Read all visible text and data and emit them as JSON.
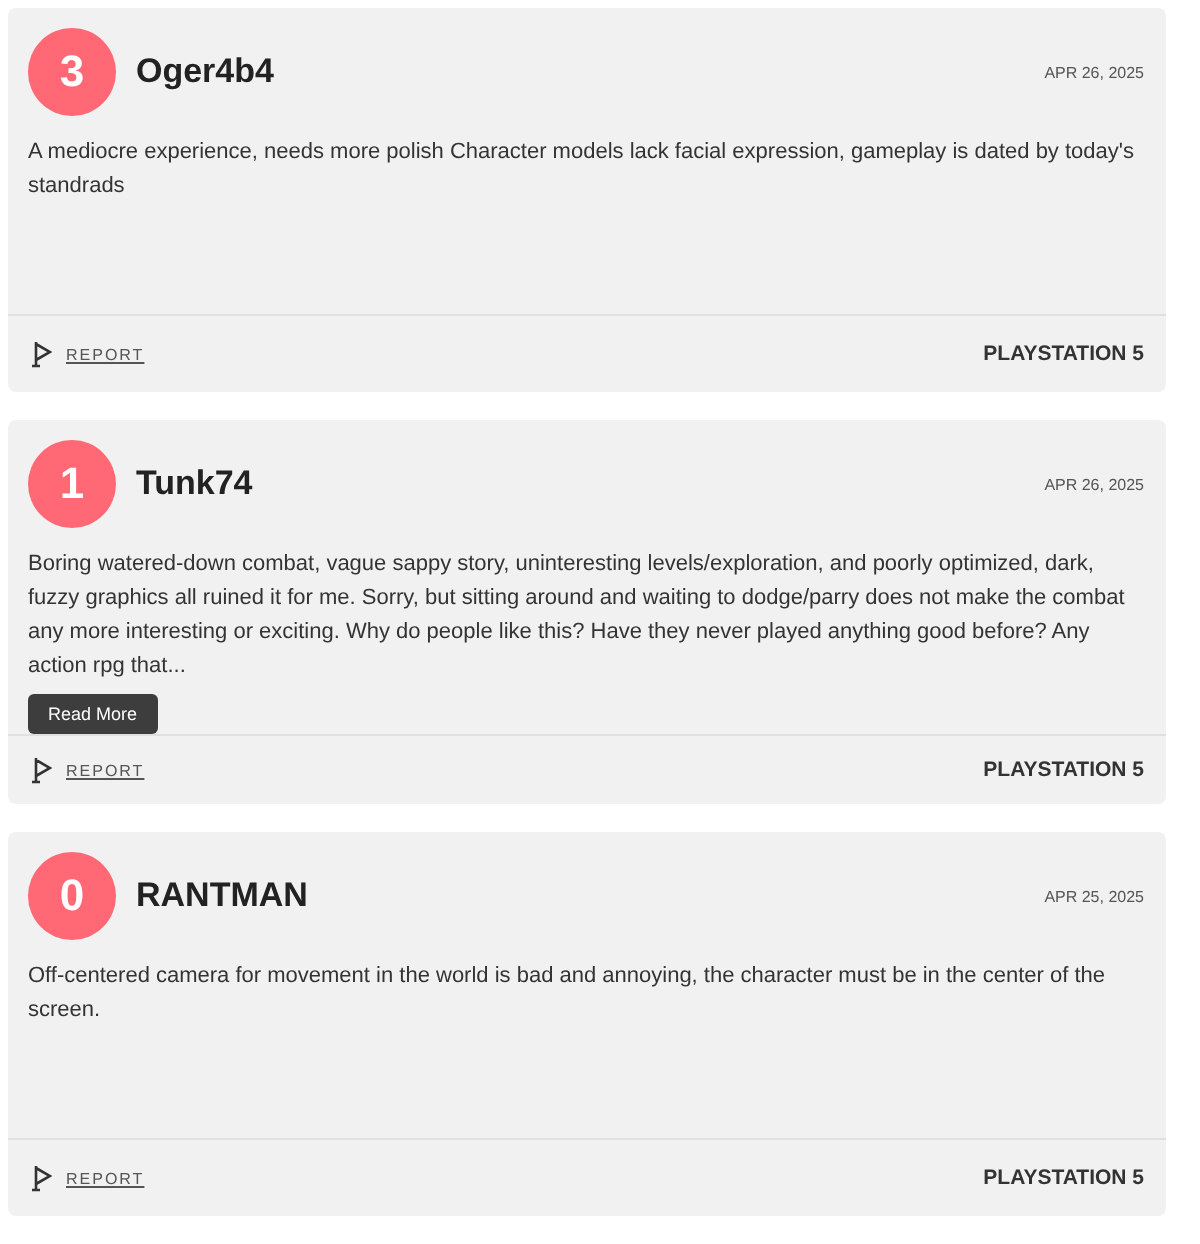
{
  "reviews": [
    {
      "score": "3",
      "author": "Oger4b4",
      "date": "APR 26, 2025",
      "text": "A mediocre experience, needs more polish Character models lack facial expression, gameplay is dated by today's standrads",
      "report": "REPORT",
      "platform": "PLAYSTATION 5"
    },
    {
      "score": "1",
      "author": "Tunk74",
      "date": "APR 26, 2025",
      "text": "Boring watered-down combat, vague sappy story, uninteresting levels/exploration, and poorly optimized, dark, fuzzy graphics all ruined it for me. Sorry, but sitting around and waiting to dodge/parry does not make the combat any more interesting or exciting. Why do people like this? Have they never played anything good before? Any action rpg that...",
      "read_more": "Read More",
      "report": "REPORT",
      "platform": "PLAYSTATION 5"
    },
    {
      "score": "0",
      "author": "RANTMAN",
      "date": "APR 25, 2025",
      "text": "Off-centered camera for movement in the world is bad and annoying, the character must be in the center of the screen.",
      "report": "REPORT",
      "platform": "PLAYSTATION 5"
    }
  ]
}
